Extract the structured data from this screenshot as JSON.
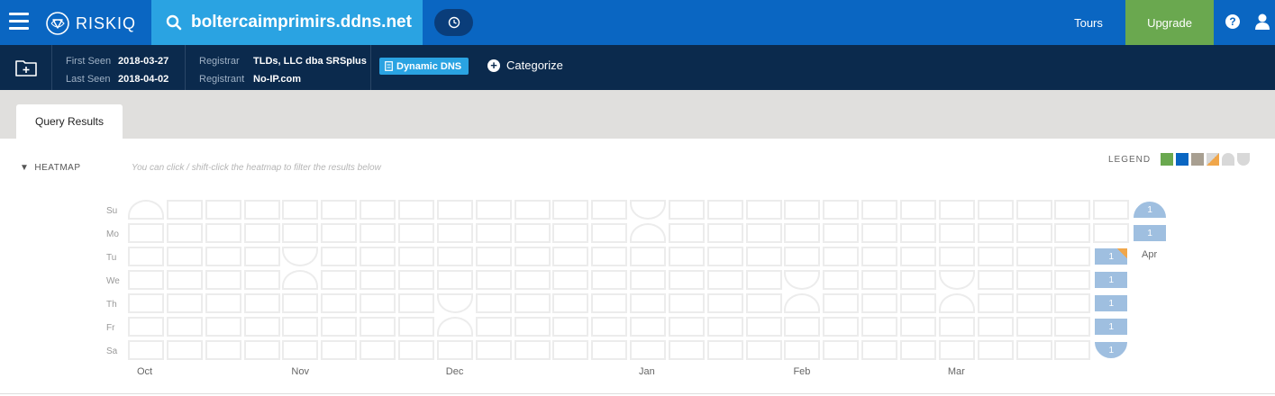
{
  "header": {
    "logo": "RISKIQ",
    "search_query": "boltercaimprimirs.ddns.net",
    "tours": "Tours",
    "upgrade": "Upgrade",
    "help": "?"
  },
  "info": {
    "first_seen_label": "First Seen",
    "first_seen": "2018-03-27",
    "last_seen_label": "Last Seen",
    "last_seen": "2018-04-02",
    "registrar_label": "Registrar",
    "registrar": "TLDs, LLC dba SRSplus",
    "registrant_label": "Registrant",
    "registrant": "No-IP.com",
    "tag": "Dynamic DNS",
    "categorize": "Categorize"
  },
  "tabs": [
    {
      "label": "Query Results"
    }
  ],
  "heatmap": {
    "title": "HEATMAP",
    "hint": "You can click / shift-click the heatmap to filter the results below",
    "legend_label": "LEGEND",
    "legend_colors": [
      "#6aa84f",
      "#0a66c2",
      "#a89f91",
      "#f0a64a",
      "#d8d8d8",
      "#d8d8d8"
    ],
    "days": [
      "Su",
      "Mo",
      "Tu",
      "We",
      "Th",
      "Fr",
      "Sa"
    ],
    "months": [
      "Oct",
      "Nov",
      "Dec",
      "Jan",
      "Feb",
      "Mar"
    ],
    "apr_label": "Apr",
    "active_color": "#9fbfe0",
    "counts": {
      "week_25": [
        "",
        "",
        "1",
        "1",
        "1",
        "1",
        "1"
      ],
      "week_26": [
        "1",
        "1",
        "",
        "",
        "",
        "",
        ""
      ]
    }
  }
}
